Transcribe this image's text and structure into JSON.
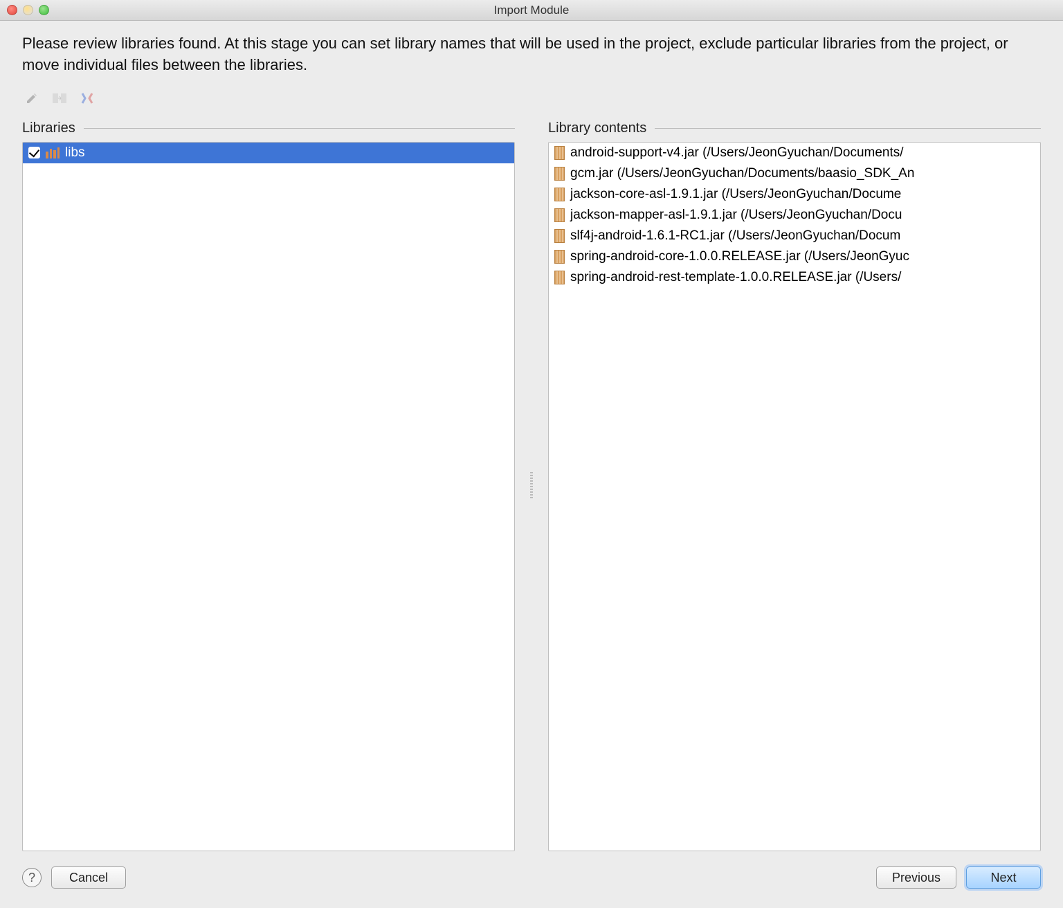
{
  "window": {
    "title": "Import Module"
  },
  "description": "Please review libraries found. At this stage you can set library names that will be used in the project, exclude particular libraries from the project, or move individual files between the libraries.",
  "panels": {
    "left": {
      "header": "Libraries"
    },
    "right": {
      "header": "Library contents"
    }
  },
  "libraries": [
    {
      "name": "libs",
      "checked": true,
      "selected": true
    }
  ],
  "contents": [
    "android-support-v4.jar (/Users/JeonGyuchan/Documents/",
    "gcm.jar (/Users/JeonGyuchan/Documents/baasio_SDK_An",
    "jackson-core-asl-1.9.1.jar (/Users/JeonGyuchan/Docume",
    "jackson-mapper-asl-1.9.1.jar (/Users/JeonGyuchan/Docu",
    "slf4j-android-1.6.1-RC1.jar (/Users/JeonGyuchan/Docum",
    "spring-android-core-1.0.0.RELEASE.jar (/Users/JeonGyuc",
    "spring-android-rest-template-1.0.0.RELEASE.jar (/Users/"
  ],
  "buttons": {
    "help": "?",
    "cancel": "Cancel",
    "previous": "Previous",
    "next": "Next"
  }
}
